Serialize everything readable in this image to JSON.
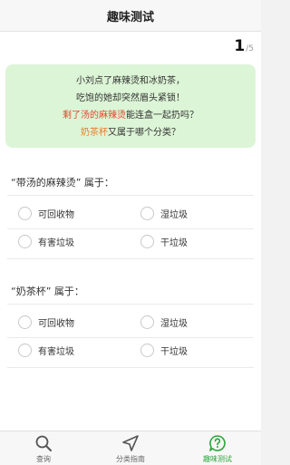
{
  "header": {
    "title": "趣味测试"
  },
  "progress": {
    "current": "1",
    "total": "/5"
  },
  "intro": {
    "line1": "小刘点了麻辣烫和冰奶茶，",
    "line2": "吃饱的她却突然眉头紧锁！",
    "line3_highlight": "剩了汤的麻辣烫",
    "line3_rest": "能连盒一起扔吗？",
    "line4_highlight": "奶茶杯",
    "line4_rest": "又属于哪个分类？"
  },
  "questions": [
    {
      "title": "“带汤的麻辣烫” 属于：",
      "options": [
        "可回收物",
        "湿垃圾",
        "有害垃圾",
        "干垃圾"
      ]
    },
    {
      "title": "“奶茶杯” 属于：",
      "options": [
        "可回收物",
        "湿垃圾",
        "有害垃圾",
        "干垃圾"
      ]
    }
  ],
  "tabs": [
    {
      "label": "查询",
      "icon": "search-icon"
    },
    {
      "label": "分类指南",
      "icon": "navigation-arrow-icon"
    },
    {
      "label": "趣味测试",
      "icon": "question-bubble-icon",
      "active": true
    }
  ],
  "colors": {
    "accent": "#2aa63a",
    "intro_bg": "#dcf5d6",
    "highlight_red": "#e0482e",
    "highlight_orange": "#ee7b2c"
  }
}
